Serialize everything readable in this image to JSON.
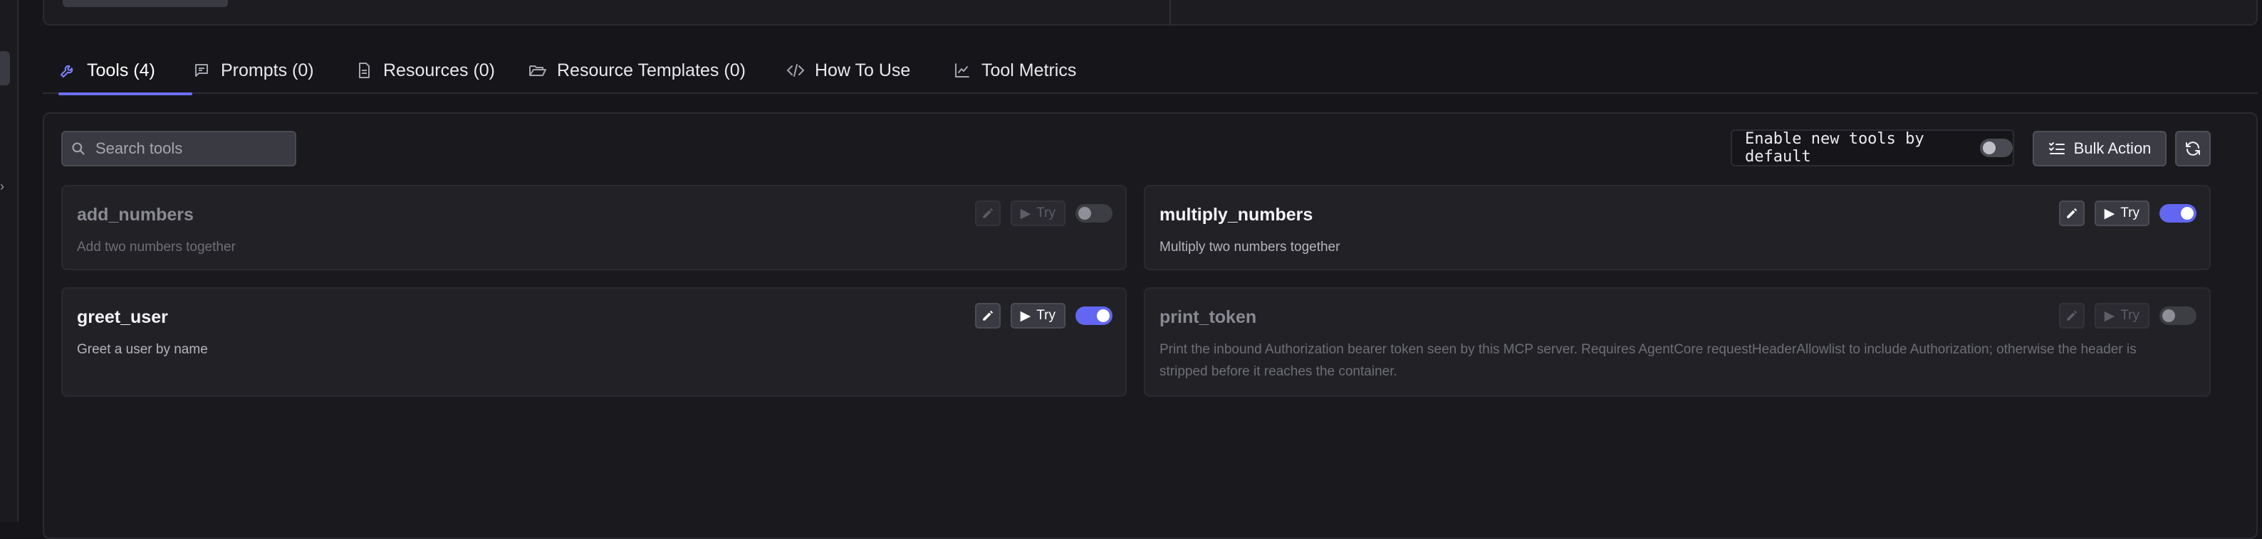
{
  "tabs": [
    {
      "label": "Tools (4)",
      "icon": "wrench-icon"
    },
    {
      "label": "Prompts (0)",
      "icon": "message-icon"
    },
    {
      "label": "Resources (0)",
      "icon": "file-icon"
    },
    {
      "label": "Resource Templates (0)",
      "icon": "folder-open-icon"
    },
    {
      "label": "How To Use",
      "icon": "code-icon"
    },
    {
      "label": "Tool Metrics",
      "icon": "line-chart-icon"
    }
  ],
  "active_tab": "Tools (4)",
  "toolbar": {
    "search_placeholder": "Search tools",
    "enable_label": "Enable new tools by default",
    "enable_default": false,
    "bulk_label": "Bulk Action"
  },
  "tools": [
    {
      "name": "add_numbers",
      "description": "Add two numbers together",
      "enabled": false,
      "try_label": "Try"
    },
    {
      "name": "multiply_numbers",
      "description": "Multiply two numbers together",
      "enabled": true,
      "try_label": "Try"
    },
    {
      "name": "greet_user",
      "description": "Greet a user by name",
      "enabled": true,
      "try_label": "Try"
    },
    {
      "name": "print_token",
      "description": "Print the inbound Authorization bearer token seen by this MCP server. Requires AgentCore requestHeaderAllowlist to include Authorization; otherwise the header is stripped before it reaches the container.",
      "enabled": false,
      "try_label": "Try"
    }
  ],
  "colors": {
    "accent": "#6266f0",
    "background": "#16161a",
    "card": "#212126"
  }
}
